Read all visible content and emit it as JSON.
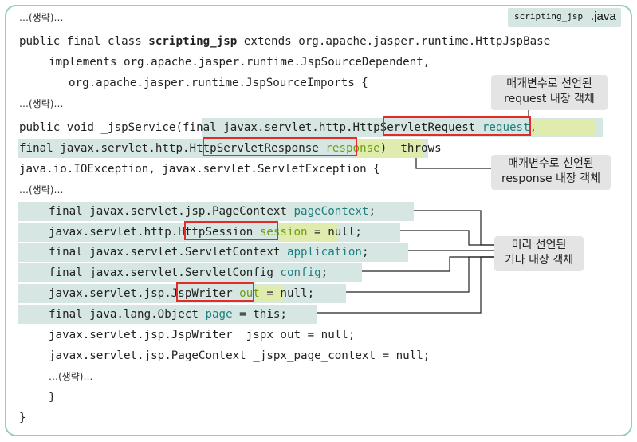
{
  "file_tag": {
    "mono": "scripting_jsp",
    "ext": ".java"
  },
  "omitted": "…(생략)…",
  "code": {
    "l1a": "public final class ",
    "l1b": "scripting_jsp",
    "l1c": " extends org.apache.jasper.runtime.HttpJspBase",
    "l2": "implements org.apache.jasper.runtime.JspSourceDependent,",
    "l3": "org.apache.jasper.runtime.JspSourceImports {",
    "l5a": "public void _jspService(final javax.servlet.http.",
    "l5b": "HttpServletRequest",
    "l5c": "request,",
    "l6a": "final javax.servlet.http.",
    "l6b": "HttpServletResponse",
    "l6c": "response",
    "l6d": ")  throws",
    "l7": "java.io.IOException, javax.servlet.ServletException {",
    "l9a": "final javax.servlet.jsp.PageContext ",
    "l9b": "pageContext",
    "l9c": ";",
    "l10a": "javax.servlet.http.",
    "l10b": "HttpSession",
    "l10c": "session",
    "l10d": " = null;",
    "l11a": "final javax.servlet.ServletContext ",
    "l11b": "application",
    "l11c": ";",
    "l12a": "final javax.servlet.ServletConfig ",
    "l12b": "config",
    "l12c": ";",
    "l13a": "javax.servlet.jsp.",
    "l13b": "JspWriter",
    "l13c": "out",
    "l13d": " = null;",
    "l14a": "final java.lang.Object ",
    "l14b": "page",
    "l14c": " = this;",
    "l15": "javax.servlet.jsp.JspWriter _jspx_out = null;",
    "l16": "javax.servlet.jsp.PageContext _jspx_page_context = null;",
    "l18": "}",
    "l19": "}"
  },
  "callouts": {
    "request": {
      "line1": "매개변수로 선언된",
      "line2": "request 내장 객체"
    },
    "response": {
      "line1": "매개변수로 선언된",
      "line2": "response 내장 객체"
    },
    "others": {
      "line1": "미리 선언된",
      "line2": "기타 내장 객체"
    }
  },
  "colors": {
    "highlight": "#d5e6e3",
    "variable_highlight": "#dfecae",
    "box": "#e32b2b",
    "border": "#9cc9c3"
  }
}
